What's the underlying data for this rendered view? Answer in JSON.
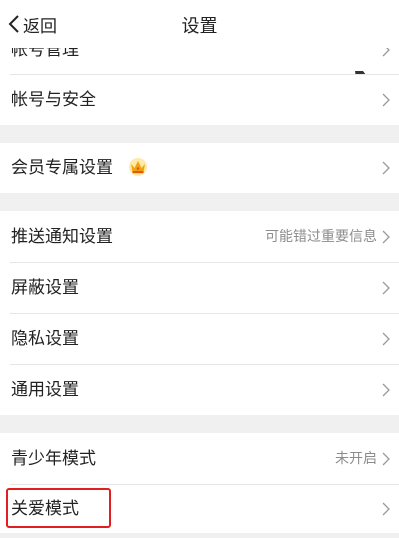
{
  "header": {
    "back_label": "返回",
    "title": "设置"
  },
  "rows": {
    "account_manage": {
      "label": "帐号管理"
    },
    "account_security": {
      "label": "帐号与安全"
    },
    "vip_settings": {
      "label": "会员专属设置"
    },
    "push_settings": {
      "label": "推送通知设置",
      "value": "可能错过重要信息"
    },
    "block_settings": {
      "label": "屏蔽设置"
    },
    "privacy_settings": {
      "label": "隐私设置"
    },
    "general_settings": {
      "label": "通用设置"
    },
    "teen_mode": {
      "label": "青少年模式",
      "value": "未开启"
    },
    "care_mode": {
      "label": "关爱模式"
    }
  },
  "icons": {
    "back": "chevron-left-icon",
    "row_arrow": "chevron-right-icon",
    "vip_badge": "crown-icon"
  },
  "colors": {
    "highlight": "#e02020",
    "secondary_text": "#8c8c8c",
    "background": "#f2f2f2"
  }
}
